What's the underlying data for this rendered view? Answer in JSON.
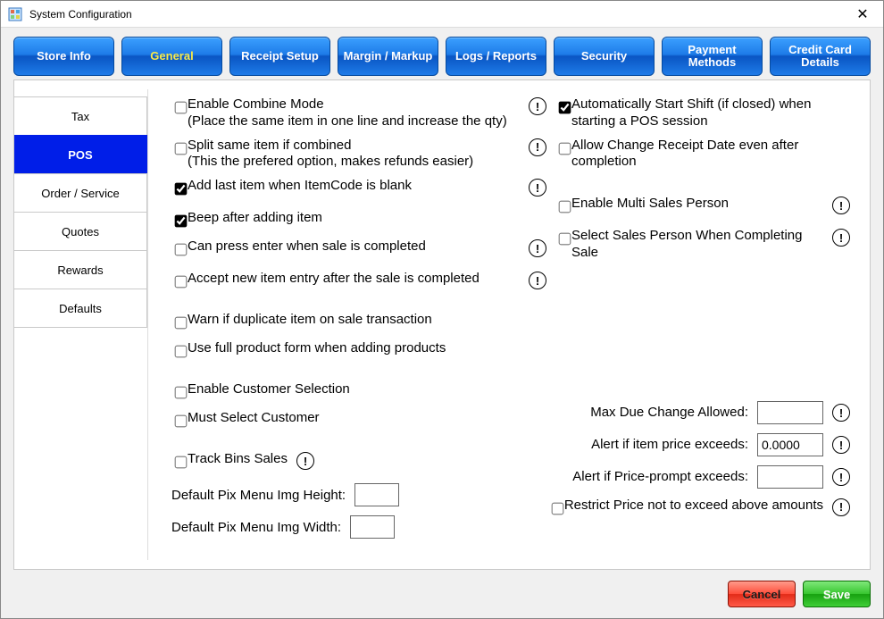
{
  "window": {
    "title": "System Configuration"
  },
  "tabs": [
    "Store Info",
    "General",
    "Receipt Setup",
    "Margin / Markup",
    "Logs / Reports",
    "Security",
    "Payment Methods",
    "Credit Card Details"
  ],
  "activeTabIndex": 1,
  "sidenav": [
    "Tax",
    "POS",
    "Order / Service",
    "Quotes",
    "Rewards",
    "Defaults"
  ],
  "activeSidenavIndex": 1,
  "left": {
    "enable_combine": "Enable Combine Mode",
    "enable_combine_sub": "(Place the same item in one line and increase the qty)",
    "split_same": "Split same item if combined",
    "split_same_sub": "(This the prefered option, makes refunds easier)",
    "add_last": "Add last item when ItemCode is blank",
    "beep": "Beep after adding item",
    "press_enter": "Can press enter when sale is completed",
    "accept_new": "Accept new item entry after the sale is completed",
    "warn_dup": "Warn if duplicate item on sale transaction",
    "use_full": "Use full product form when adding products",
    "enable_cust": "Enable Customer Selection",
    "must_cust": "Must Select Customer",
    "track_bins": "Track Bins Sales",
    "pix_h_label": "Default Pix Menu Img Height:",
    "pix_w_label": "Default Pix Menu Img Width:",
    "pix_h_value": "",
    "pix_w_value": ""
  },
  "right": {
    "auto_shift": "Automatically Start Shift (if closed) when starting a POS session",
    "allow_change_date": "Allow Change Receipt Date even after completion",
    "enable_multi_sp": "Enable Multi Sales Person",
    "select_sp_complete": "Select Sales Person When Completing Sale",
    "max_due_label": "Max Due Change Allowed:",
    "max_due_value": "",
    "alert_item_label": "Alert if item price exceeds:",
    "alert_item_value": "0.0000",
    "alert_prompt_label": "Alert if Price-prompt exceeds:",
    "alert_prompt_value": "",
    "restrict_price": "Restrict Price not to exceed above amounts"
  },
  "checked": {
    "enable_combine": false,
    "split_same": false,
    "add_last": true,
    "beep": true,
    "press_enter": false,
    "accept_new": false,
    "warn_dup": false,
    "use_full": false,
    "enable_cust": false,
    "must_cust": false,
    "track_bins": false,
    "auto_shift": true,
    "allow_change_date": false,
    "enable_multi_sp": false,
    "select_sp_complete": false,
    "restrict_price": false
  },
  "footer": {
    "cancel": "Cancel",
    "save": "Save"
  }
}
